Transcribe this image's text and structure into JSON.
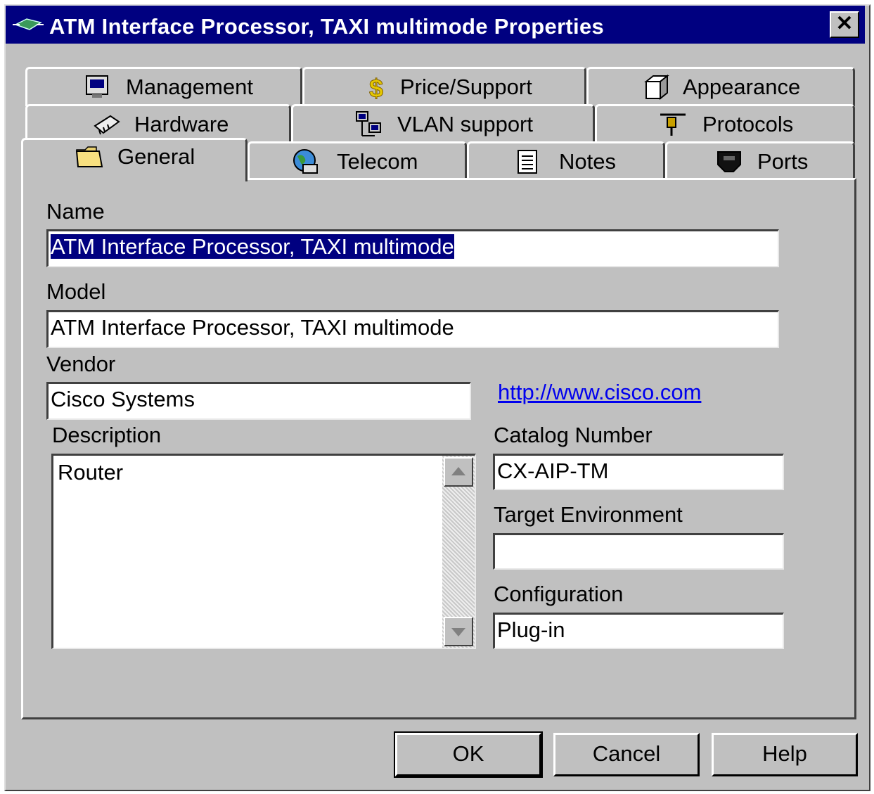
{
  "window": {
    "title": "ATM Interface Processor, TAXI multimode Properties",
    "close_symbol": "✕",
    "title_icon": "router-card-icon"
  },
  "tabs": [
    {
      "label": "Management",
      "icon": "management-icon"
    },
    {
      "label": "Price/Support",
      "icon": "dollar-icon"
    },
    {
      "label": "Appearance",
      "icon": "cube-icon"
    },
    {
      "label": "Hardware",
      "icon": "chip-icon"
    },
    {
      "label": "VLAN support",
      "icon": "network-computers-icon"
    },
    {
      "label": "Protocols",
      "icon": "connector-icon"
    },
    {
      "label": "General",
      "icon": "folder-icon",
      "active": true
    },
    {
      "label": "Telecom",
      "icon": "globe-phone-icon"
    },
    {
      "label": "Notes",
      "icon": "notepad-icon"
    },
    {
      "label": "Ports",
      "icon": "port-icon"
    }
  ],
  "form": {
    "name_label": "Name",
    "name_value": "ATM Interface Processor, TAXI multimode",
    "model_label": "Model",
    "model_value": "ATM Interface Processor, TAXI multimode",
    "vendor_label": "Vendor",
    "vendor_value": "Cisco Systems",
    "vendor_link": "http://www.cisco.com",
    "description_label": "Description",
    "description_value": "Router",
    "catalog_label": "Catalog Number",
    "catalog_value": "CX-AIP-TM",
    "target_label": "Target Environment",
    "target_value": "",
    "config_label": "Configuration",
    "config_value": "Plug-in"
  },
  "buttons": {
    "ok": "OK",
    "cancel": "Cancel",
    "help": "Help"
  },
  "colors": {
    "titlebar": "#000080",
    "face": "#c0c0c0",
    "selection": "#000080",
    "link": "#0000ee"
  }
}
